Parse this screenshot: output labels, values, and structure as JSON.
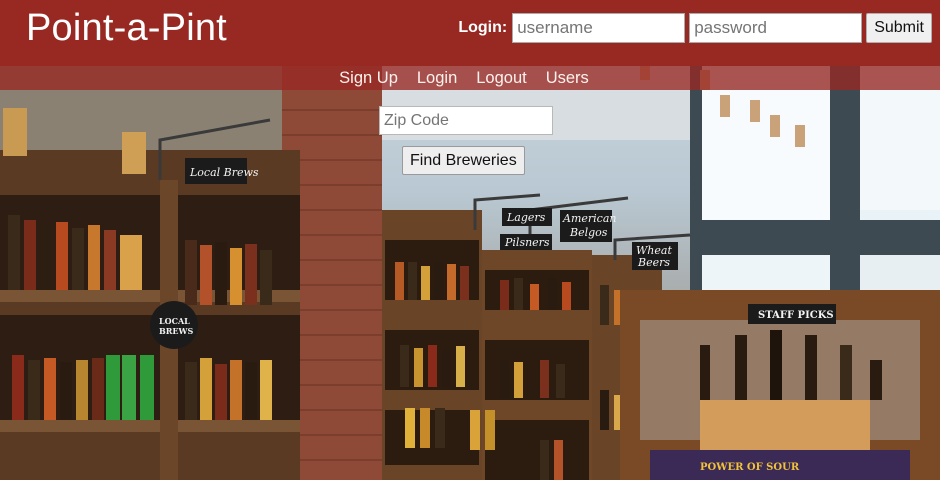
{
  "header": {
    "brand": "Point-a-Pint",
    "login_label": "Login:",
    "username_placeholder": "username",
    "password_placeholder": "password",
    "submit_label": "Submit",
    "color": "#972822"
  },
  "nav": {
    "items": [
      {
        "label": "Sign Up"
      },
      {
        "label": "Login"
      },
      {
        "label": "Logout"
      },
      {
        "label": "Users"
      }
    ]
  },
  "search": {
    "zip_placeholder": "Zip Code",
    "button_label": "Find Breweries"
  },
  "background": {
    "signs": [
      "Local Brews",
      "Lagers",
      "American Belgos",
      "Pilsners",
      "Wheat Beers",
      "STAFF PICKS",
      "LOCAL BREWS",
      "POWER OF SOUR"
    ]
  }
}
